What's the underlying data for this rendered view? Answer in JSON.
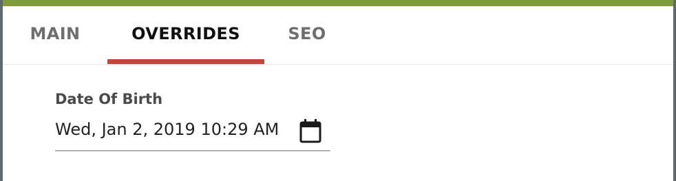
{
  "tabs": [
    {
      "label": "MAIN",
      "active": false
    },
    {
      "label": "OVERRIDES",
      "active": true
    },
    {
      "label": "SEO",
      "active": false
    }
  ],
  "colors": {
    "top_bar": "#7f9b3c",
    "active_tab_underline": "#c0453a"
  },
  "field": {
    "label": "Date Of Birth",
    "value": "Wed, Jan 2, 2019 10:29 AM",
    "icon": "calendar-icon"
  }
}
